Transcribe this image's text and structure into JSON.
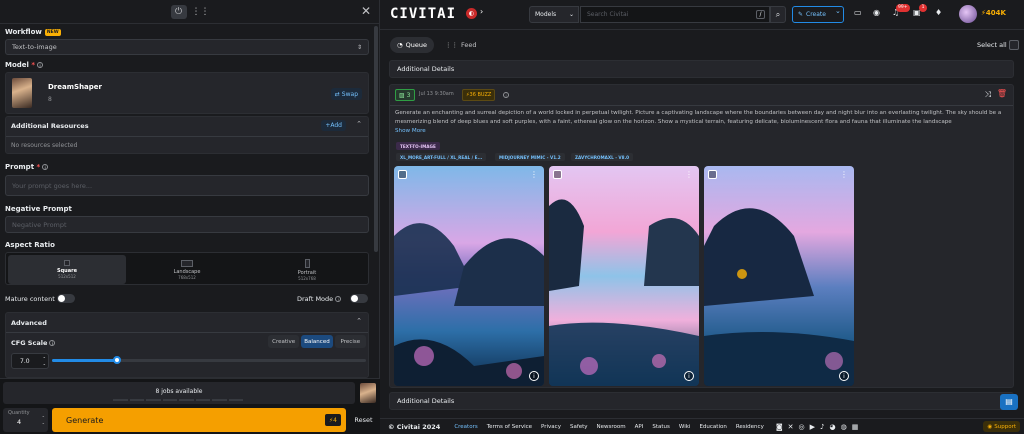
{
  "left": {
    "workflow_label": "Workflow",
    "workflow_badge": "NEW",
    "workflow_value": "Text-to-image",
    "model_label": "Model",
    "model_required": "*",
    "model_name": "DreamShaper",
    "model_version": "8",
    "swap_label": "Swap",
    "additional_resources": "Additional Resources",
    "add_label": "Add",
    "no_resources": "No resources selected",
    "prompt_label": "Prompt",
    "prompt_placeholder": "Your prompt goes here...",
    "negative_label": "Negative Prompt",
    "negative_placeholder": "Negative Prompt",
    "aspect_label": "Aspect Ratio",
    "aspect": [
      {
        "name": "Square",
        "dims": "512x512"
      },
      {
        "name": "Landscape",
        "dims": "768x512"
      },
      {
        "name": "Portrait",
        "dims": "512x768"
      }
    ],
    "mature_label": "Mature content",
    "draft_label": "Draft Mode",
    "advanced_label": "Advanced",
    "cfg_label": "CFG Scale",
    "cfg_value": "7.0",
    "cfg_modes": [
      "Creative",
      "Balanced",
      "Precise"
    ],
    "jobs_available": "8 jobs available",
    "quantity_label": "Quantity",
    "quantity_value": "4",
    "generate_label": "Generate",
    "generate_cost": "4",
    "reset_label": "Reset"
  },
  "header": {
    "logo": "CIVITAI",
    "search_scope": "Models",
    "search_placeholder": "Search Civitai",
    "slash": "/",
    "create_label": "Create",
    "notif_count": "99+",
    "msg_count": "1",
    "buzz": "404K"
  },
  "tabs": {
    "queue": "Queue",
    "feed": "Feed",
    "select_all": "Select all"
  },
  "details1": "Additional Details",
  "job": {
    "count": "3",
    "time": "Jul 13 9:30am",
    "buzz": "36 BUZZ",
    "prompt": "Generate an enchanting and surreal depiction of a world locked in perpetual twilight. Picture a captivating landscape where the boundaries between day and night blur into an everlasting twilight. The sky should be a mesmerizing blend of deep blues and soft purples, with a faint, ethereal glow on the horizon. Show a mystical terrain, featuring delicate, bioluminescent flora and fauna that illuminate the landscape",
    "show_more": "Show More",
    "type_tag": "TEXT-TO-IMAGE",
    "tags": [
      "XL_MORE_ART-FULL / XL_REAL / E...",
      "MIDJOURNEY MIMIC - V1.2",
      "ZAVYCHROMAXL - V8.0"
    ]
  },
  "details2": "Additional Details",
  "footer": {
    "copyright": "© Civitai 2024",
    "links": [
      "Creators",
      "Terms of Service",
      "Privacy",
      "Safety",
      "Newsroom",
      "API",
      "Status",
      "Wiki",
      "Education",
      "Residency"
    ],
    "support": "Support"
  },
  "colors": {
    "accent": "#228be6",
    "generate": "#f59f00",
    "buzz": "#fab005",
    "tag_blue": "#74c0fc",
    "notif": "#e03131"
  }
}
